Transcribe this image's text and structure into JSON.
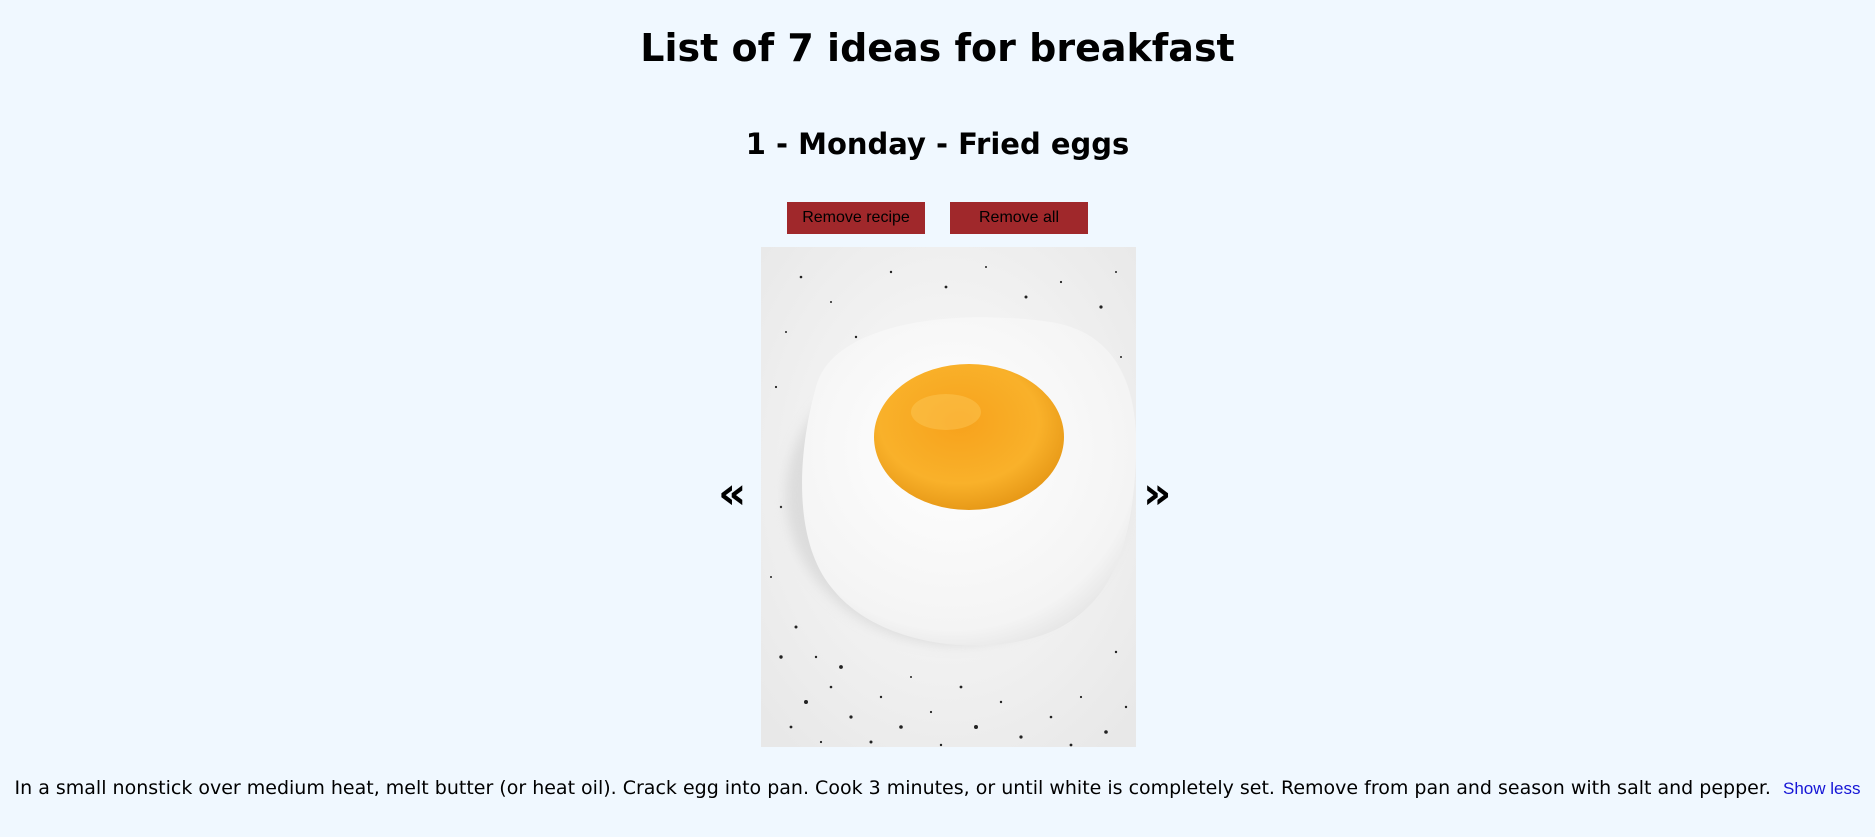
{
  "page": {
    "title": "List of 7 ideas for breakfast"
  },
  "recipe": {
    "heading": "1 - Monday - Fried eggs",
    "image_alt": "fried-egg-photo",
    "description": "In a small nonstick over medium heat, melt butter (or heat oil). Crack egg into pan. Cook 3 minutes, or until white is completely set. Remove from pan and season with salt and pepper.",
    "toggle_label": "Show less"
  },
  "actions": {
    "remove_recipe_label": "Remove recipe",
    "remove_all_label": "Remove all"
  },
  "carousel": {
    "prev_label": "«",
    "next_label": "»"
  },
  "colors": {
    "background": "#f0f8ff",
    "button": "#a0282b",
    "link": "#1515d6"
  }
}
